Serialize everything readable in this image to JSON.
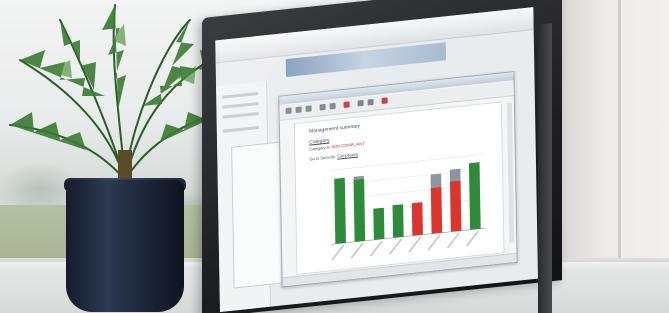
{
  "screen_document": {
    "title": "Management summary",
    "category_label": "Category",
    "category_line_prefix": "Category A:",
    "category_status": "NON COMPLIANT",
    "link_prefix": "Go to Security:",
    "link_text": "Compliance"
  },
  "chart_data": {
    "type": "bar",
    "title": "",
    "xlabel": "",
    "ylabel": "",
    "ylim": [
      0,
      100
    ],
    "grid": true,
    "legend": "none",
    "categories": [
      "",
      "",
      "",
      "",
      "",
      "",
      "",
      ""
    ],
    "series": [
      {
        "values": [
          88,
          88,
          42,
          44,
          44,
          80,
          84,
          90
        ]
      }
    ],
    "bar_colors": [
      "#2f8a3c",
      "#2f8a3c",
      "#2f8a3c",
      "#2f8a3c",
      "#d9372d",
      "#d9372d",
      "#d9372d",
      "#2f8a3c"
    ],
    "cap_values": [
      0,
      4,
      0,
      0,
      0,
      18,
      16,
      0
    ],
    "cap_color": "#8d969e"
  },
  "colors": {
    "compliant": "#2f8a3c",
    "non_compliant": "#d9372d",
    "grey_cap": "#8d969e",
    "pot": "#1c2436",
    "leaf": "#2f6a2a"
  }
}
